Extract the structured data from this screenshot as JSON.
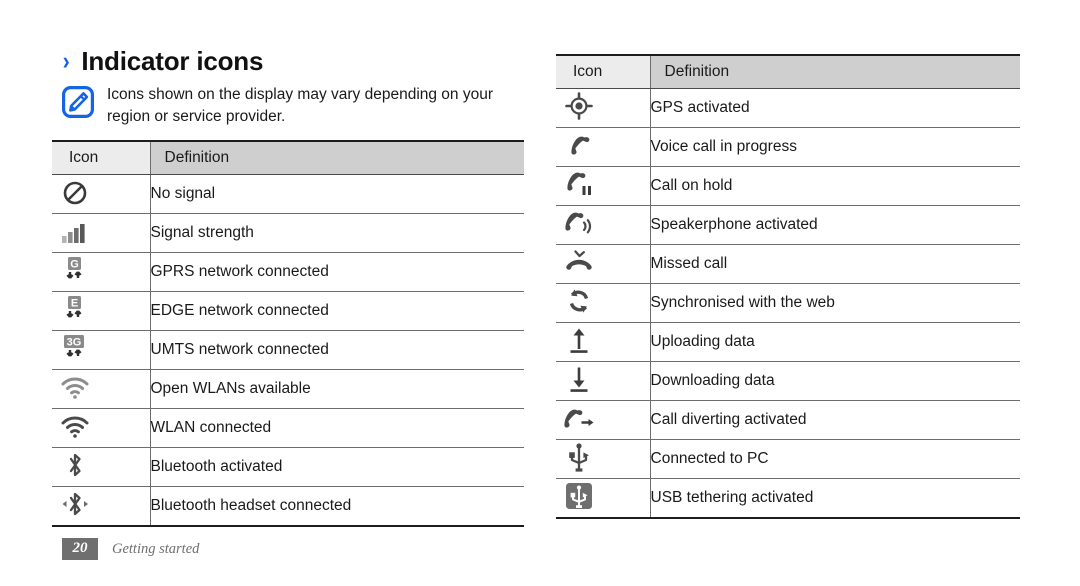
{
  "heading": {
    "chevron": "›",
    "title": "Indicator icons"
  },
  "note": {
    "icon_name": "note-pen-icon",
    "text": "Icons shown on the display may vary depending on your region or service provider."
  },
  "left_table": {
    "columns": [
      "Icon",
      "Definition"
    ],
    "rows": [
      {
        "icon": "no-signal-icon",
        "definition": "No signal"
      },
      {
        "icon": "signal-strength-icon",
        "definition": "Signal strength"
      },
      {
        "icon": "gprs-network-icon",
        "definition": "GPRS network connected"
      },
      {
        "icon": "edge-network-icon",
        "definition": "EDGE network connected"
      },
      {
        "icon": "umts-network-icon",
        "definition": "UMTS network connected"
      },
      {
        "icon": "open-wlan-icon",
        "definition": "Open WLANs available"
      },
      {
        "icon": "wlan-connected-icon",
        "definition": "WLAN connected"
      },
      {
        "icon": "bluetooth-activated-icon",
        "definition": "Bluetooth activated"
      },
      {
        "icon": "bluetooth-headset-icon",
        "definition": "Bluetooth headset connected"
      }
    ]
  },
  "right_table": {
    "columns": [
      "Icon",
      "Definition"
    ],
    "rows": [
      {
        "icon": "gps-activated-icon",
        "definition": "GPS activated"
      },
      {
        "icon": "voice-call-icon",
        "definition": "Voice call in progress"
      },
      {
        "icon": "call-on-hold-icon",
        "definition": "Call on hold"
      },
      {
        "icon": "speakerphone-icon",
        "definition": "Speakerphone activated"
      },
      {
        "icon": "missed-call-icon",
        "definition": "Missed call"
      },
      {
        "icon": "sync-web-icon",
        "definition": "Synchronised with the web"
      },
      {
        "icon": "upload-data-icon",
        "definition": "Uploading data"
      },
      {
        "icon": "download-data-icon",
        "definition": "Downloading data"
      },
      {
        "icon": "call-diverting-icon",
        "definition": "Call diverting activated"
      },
      {
        "icon": "usb-connected-icon",
        "definition": "Connected to PC"
      },
      {
        "icon": "usb-tethering-icon",
        "definition": "USB tethering activated"
      }
    ]
  },
  "footer": {
    "page_number": "20",
    "section": "Getting started"
  },
  "colors": {
    "accent_blue": "#1464e6",
    "header_icon_bg": "#ececec",
    "header_def_bg": "#cfcfcf",
    "footer_gray": "#6f6f6f",
    "icon_gray": "#575757"
  }
}
